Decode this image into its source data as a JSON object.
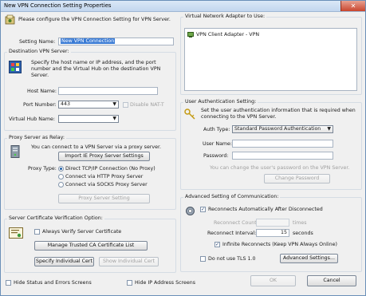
{
  "window": {
    "title": "New VPN Connection Setting Properties",
    "close_glyph": "✕"
  },
  "intro": {
    "text": "Please configure the VPN Connection Setting for VPN Server."
  },
  "setting_name": {
    "label": "Setting Name:",
    "value": "New VPN Connection"
  },
  "destination": {
    "group_label": "Destination VPN Server:",
    "description": "Specify the host name or IP address, and the port number and the Virtual Hub on the destination VPN Server.",
    "host_label": "Host Name:",
    "host_value": "",
    "port_label": "Port Number:",
    "port_value": "443",
    "disable_natt_label": "Disable NAT-T",
    "hub_label": "Virtual Hub Name:",
    "hub_value": ""
  },
  "proxy": {
    "group_label": "Proxy Server as Relay:",
    "description": "You can connect to a VPN Server via a proxy server.",
    "import_button": "Import IE Proxy Server Settings",
    "type_label": "Proxy Type:",
    "options": [
      "Direct TCP/IP Connection (No Proxy)",
      "Connect via HTTP Proxy Server",
      "Connect via SOCKS Proxy Server"
    ],
    "selected_option": "Direct TCP/IP Connection (No Proxy)",
    "setting_button": "Proxy Server Setting"
  },
  "cert": {
    "group_label": "Server Certificate Verification Option:",
    "always_verify_label": "Always Verify Server Certificate",
    "manage_button": "Manage Trusted CA Certificate List",
    "specify_button": "Specify Individual Cert",
    "show_button": "Show Individual Cert"
  },
  "adapter": {
    "group_label": "Virtual Network Adapter to Use:",
    "items": [
      "VPN Client Adapter - VPN"
    ]
  },
  "auth": {
    "group_label": "User Authentication Setting:",
    "description": "Set the user authentication information that is required when connecting to the VPN Server.",
    "type_label": "Auth Type:",
    "type_value": "Standard Password Authentication",
    "username_label": "User Name:",
    "username_value": "",
    "password_label": "Password:",
    "password_value": "",
    "hint": "You can change the user's password on the VPN Server.",
    "change_button": "Change Password"
  },
  "advanced": {
    "group_label": "Advanced Setting of Communication:",
    "reconnect_label": "Reconnects Automatically After Disconnected",
    "reconnect_count_label": "Reconnect Count:",
    "reconnect_count_value": "",
    "times_label": "times",
    "reconnect_interval_label": "Reconnect Interval:",
    "reconnect_interval_value": "15",
    "seconds_label": "seconds",
    "infinite_label": "Infinite Reconnects (Keep VPN Always Online)",
    "no_tls_label": "Do not use TLS 1.0",
    "advanced_button": "Advanced Settings..."
  },
  "footer": {
    "hide_status_label": "Hide Status and Errors Screens",
    "hide_ip_label": "Hide IP Address Screens",
    "ok_button": "OK",
    "cancel_button": "Cancel"
  },
  "check_glyph": "✓",
  "colors": {
    "titlebar": "#c2d6ee",
    "selection": "#3a7bd5",
    "close": "#c9452d"
  }
}
